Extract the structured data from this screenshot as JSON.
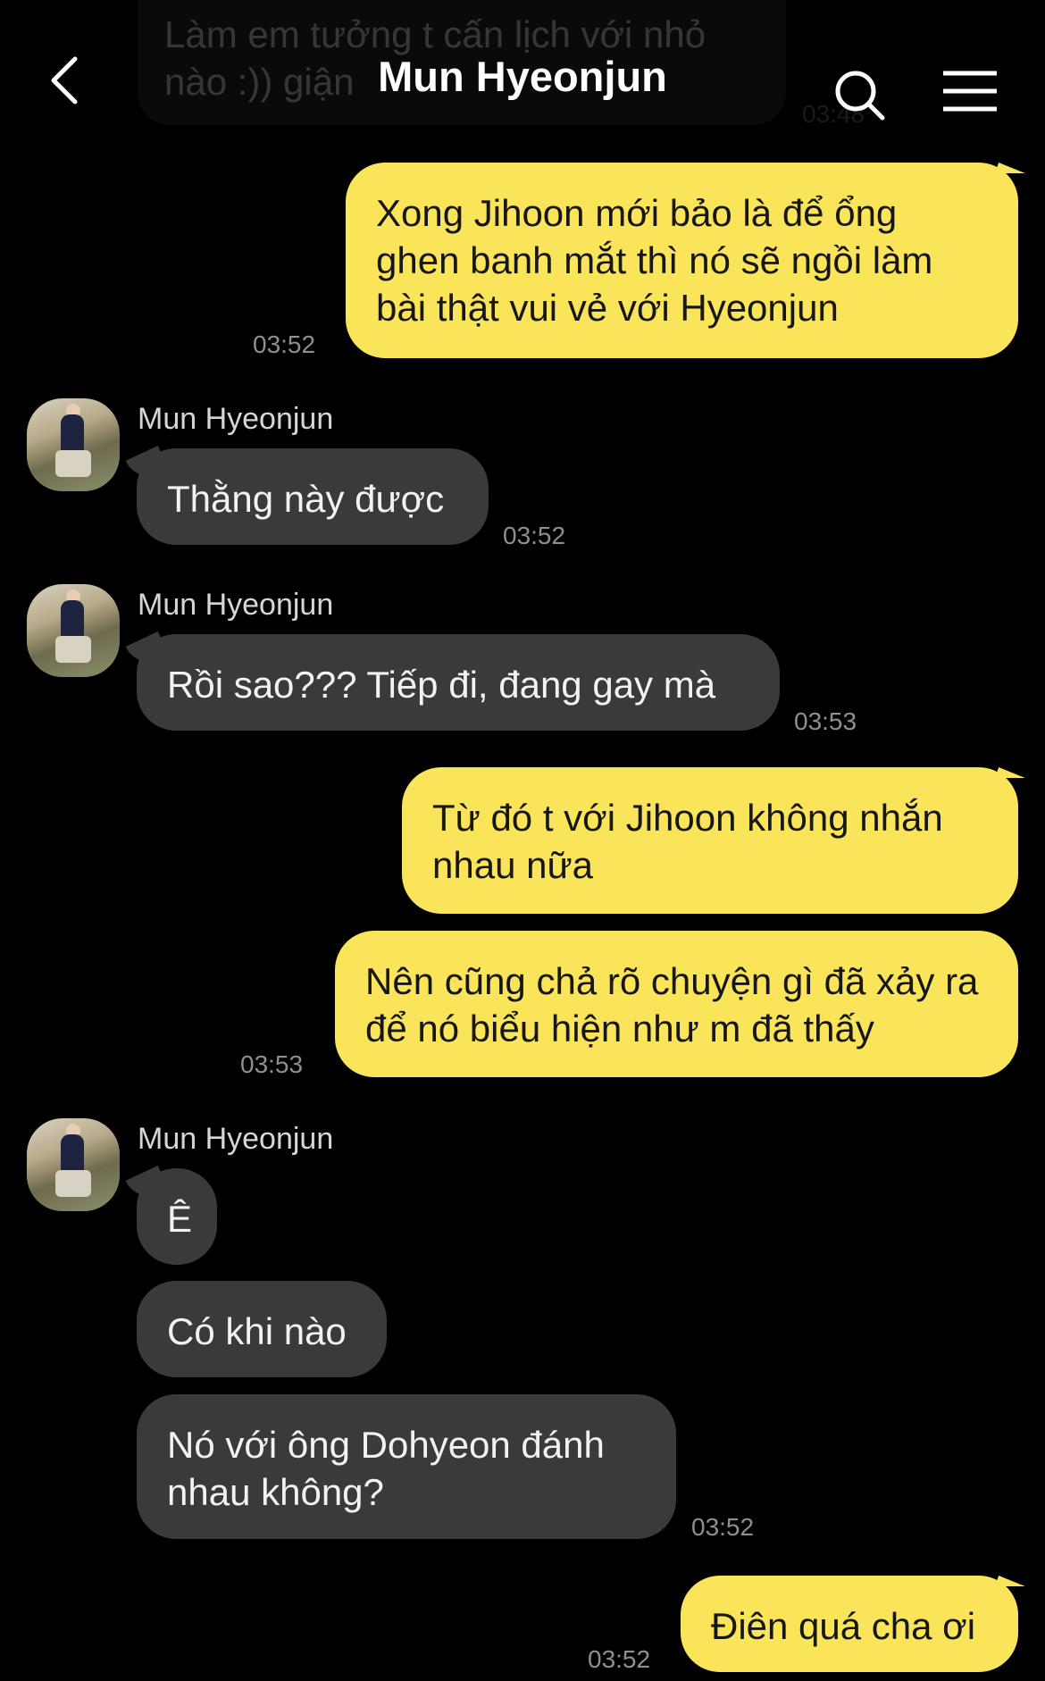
{
  "header": {
    "title": "Mun Hyeonjun"
  },
  "ghost_message": {
    "text": "Làm em tưởng t cấn lịch với nhỏ nào :)) giận",
    "time": "03:48"
  },
  "messages": [
    {
      "side": "mine",
      "text": "Xong Jihoon mới bảo là để ổng ghen banh mắt thì nó sẽ ngồi làm bài thật vui vẻ với Hyeonjun",
      "time": "03:52"
    },
    {
      "side": "theirs",
      "sender": "Mun Hyeonjun",
      "text": "Thằng này được",
      "time": "03:52"
    },
    {
      "side": "theirs",
      "sender": "Mun Hyeonjun",
      "text": "Rồi sao??? Tiếp đi, đang gay mà",
      "time": "03:53"
    },
    {
      "side": "mine",
      "text": "Từ đó t với Jihoon không nhắn nhau nữa"
    },
    {
      "side": "mine",
      "text": "Nên cũng chả rõ chuyện gì đã xảy ra để nó biểu hiện như m đã thấy",
      "time": "03:53"
    },
    {
      "side": "theirs",
      "sender": "Mun Hyeonjun",
      "text": "Ê"
    },
    {
      "side": "theirs",
      "text": "Có khi nào"
    },
    {
      "side": "theirs",
      "text": "Nó với ông Dohyeon đánh nhau không?",
      "time": "03:52"
    },
    {
      "side": "mine",
      "text": "Điên quá cha ơi",
      "time": "03:52"
    }
  ],
  "icons": {
    "back": "chevron-left-icon",
    "search": "search-icon",
    "menu": "menu-icon"
  }
}
